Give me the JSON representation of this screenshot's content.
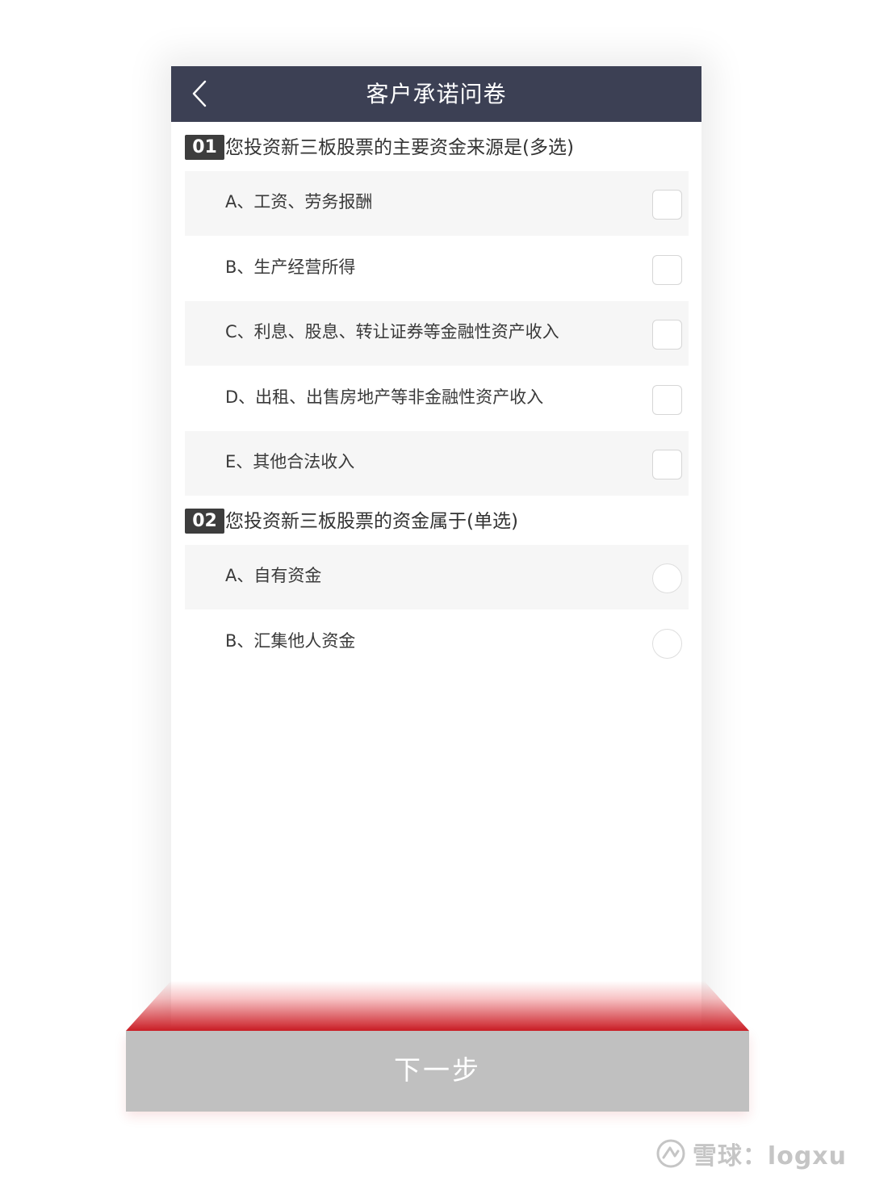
{
  "header": {
    "title": "客户承诺问卷",
    "back_icon": "chevron-left-icon"
  },
  "questions": [
    {
      "number": "01",
      "text": "您投资新三板股票的主要资金来源是(多选)",
      "input_type": "checkbox",
      "options": [
        {
          "label": "A、工资、劳务报酬",
          "checked": false
        },
        {
          "label": "B、生产经营所得",
          "checked": false
        },
        {
          "label": "C、利息、股息、转让证券等金融性资产收入",
          "checked": false
        },
        {
          "label": "D、出租、出售房地产等非金融性资产收入",
          "checked": false
        },
        {
          "label": "E、其他合法收入",
          "checked": false
        }
      ]
    },
    {
      "number": "02",
      "text": "您投资新三板股票的资金属于(单选)",
      "input_type": "radio",
      "options": [
        {
          "label": "A、自有资金",
          "selected": false
        },
        {
          "label": "B、汇集他人资金",
          "selected": false
        }
      ]
    }
  ],
  "footer": {
    "next_label": "下一步"
  },
  "watermark": {
    "text": "雪球：logxu"
  },
  "colors": {
    "header_bg": "#3c4054",
    "button_bg": "#c0c0c0",
    "accent_red": "#c8161e",
    "option_shade": "#f6f6f6"
  }
}
